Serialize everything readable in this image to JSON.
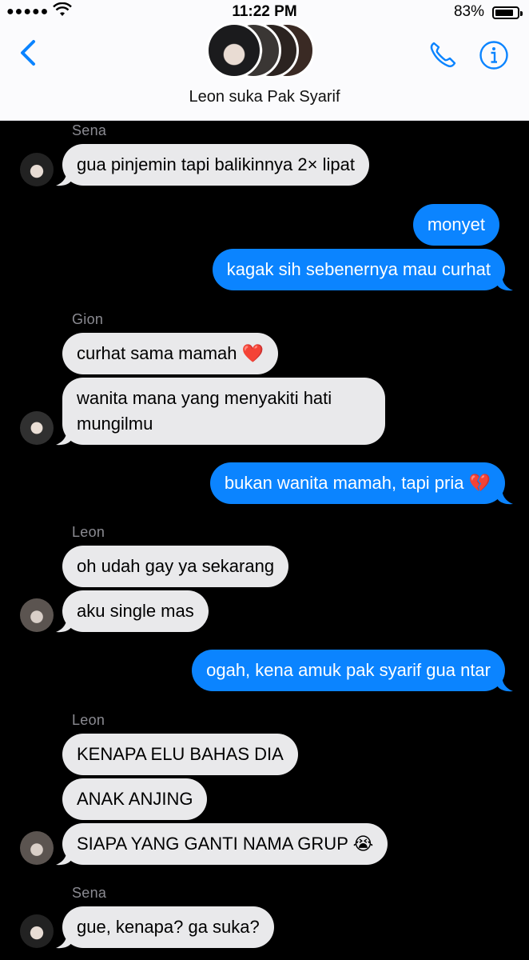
{
  "status_bar": {
    "signal": "●●●●●",
    "time": "11:22 PM",
    "battery_percent": "83%",
    "battery_level": 0.83
  },
  "header": {
    "title": "Leon suka Pak Syarif",
    "back_icon": "chevron-left-icon",
    "call_icon": "phone-icon",
    "info_icon": "info-icon",
    "accent": "#0b84ff"
  },
  "messages": [
    {
      "sender": "Sena",
      "dir": "in",
      "text": "gua pinjemin tapi balikinnya 2× lipat"
    },
    {
      "dir": "out",
      "text": "monyet"
    },
    {
      "dir": "out",
      "text": "kagak sih sebenernya mau curhat"
    },
    {
      "sender": "Gion",
      "dir": "in",
      "text": "curhat sama mamah ❤️"
    },
    {
      "dir": "in",
      "text": "wanita mana yang menyakiti hati mungilmu"
    },
    {
      "dir": "out",
      "text": "bukan wanita mamah, tapi pria 💔"
    },
    {
      "sender": "Leon",
      "dir": "in",
      "text": "oh udah gay ya sekarang"
    },
    {
      "dir": "in",
      "text": "aku single mas"
    },
    {
      "dir": "out",
      "text": "ogah, kena amuk pak syarif gua ntar"
    },
    {
      "sender": "Leon",
      "dir": "in",
      "text": "KENAPA ELU BAHAS DIA"
    },
    {
      "dir": "in",
      "text": "ANAK ANJING"
    },
    {
      "dir": "in",
      "text": "SIAPA YANG GANTI NAMA GRUP 😭"
    },
    {
      "sender": "Sena",
      "dir": "in",
      "text": "gue, kenapa? ga suka?"
    }
  ]
}
